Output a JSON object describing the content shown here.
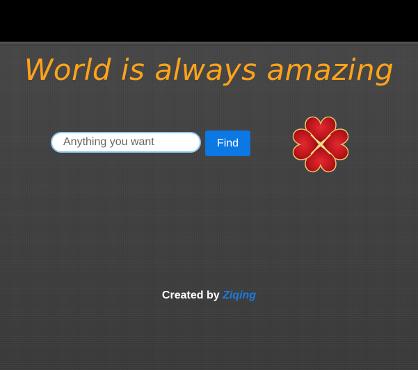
{
  "header": {
    "headline": "World is always amazing"
  },
  "search": {
    "placeholder": "Anything you want",
    "value": "",
    "button_label": "Find"
  },
  "decoration": {
    "icon": "four-leaf-heart-clover-icon",
    "colors": [
      "#c4151c",
      "#e8c56a"
    ]
  },
  "footer": {
    "created_by_label": "Created by",
    "author_name": "Ziqing"
  },
  "colors": {
    "headline": "#ffa31a",
    "button": "#0b78e3",
    "author_link": "#1a7be0"
  }
}
